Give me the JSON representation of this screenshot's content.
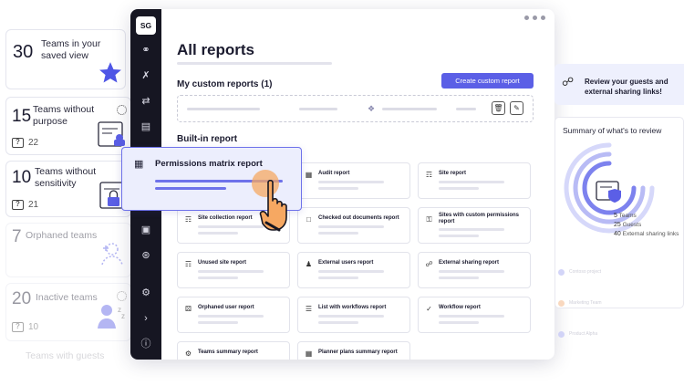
{
  "teams_cards": [
    {
      "number": "30",
      "label": "Teams in your saved view"
    },
    {
      "number": "15",
      "label": "Teams without purpose",
      "count": "22"
    },
    {
      "number": "10",
      "label": "Teams without sensitivity",
      "count": "21"
    },
    {
      "number": "7",
      "label": "Orphaned teams"
    },
    {
      "number": "20",
      "label": "Inactive teams",
      "count": "10"
    },
    {
      "label": "Teams with guests"
    }
  ],
  "window": {
    "logo": "SG",
    "title": "All reports",
    "custom_section": "My custom reports (1)",
    "create_button": "Create custom report",
    "builtin_section": "Built-in report"
  },
  "reports": [
    {
      "name": "Audit report",
      "icon": "audit-icon"
    },
    {
      "name": "Site report",
      "icon": "site-icon"
    },
    {
      "name": "Site collection report",
      "icon": "site-collection-icon"
    },
    {
      "name": "Checked out documents report",
      "icon": "document-icon"
    },
    {
      "name": "Sites with custom permissions report",
      "icon": "key-icon"
    },
    {
      "name": "Unused site report",
      "icon": "site-icon"
    },
    {
      "name": "External users report",
      "icon": "users-icon"
    },
    {
      "name": "External sharing report",
      "icon": "sharing-icon"
    },
    {
      "name": "Orphaned user report",
      "icon": "user-icon"
    },
    {
      "name": "List with workflows report",
      "icon": "list-icon"
    },
    {
      "name": "Workflow report",
      "icon": "workflow-icon"
    },
    {
      "name": "Teams summary report",
      "icon": "teams-icon"
    },
    {
      "name": "Planner plans summary report",
      "icon": "planner-icon"
    }
  ],
  "floating_card": {
    "name": "Permissions matrix report"
  },
  "right_panel": {
    "guest_text": "Review your guests and external sharing links!",
    "summary_title": "Summary of what's to review",
    "legend": [
      {
        "value": "5",
        "label": "Teams"
      },
      {
        "value": "25",
        "label": "Guests"
      },
      {
        "value": "40",
        "label": "External sharing links"
      }
    ],
    "ghost_rows": [
      "Contoso project",
      "Marketing Team",
      "Product Alpha"
    ]
  },
  "colors": {
    "accent": "#5b5fe6",
    "rail": "#161622",
    "star": "#4f56e6",
    "orange": "#f6a862"
  }
}
